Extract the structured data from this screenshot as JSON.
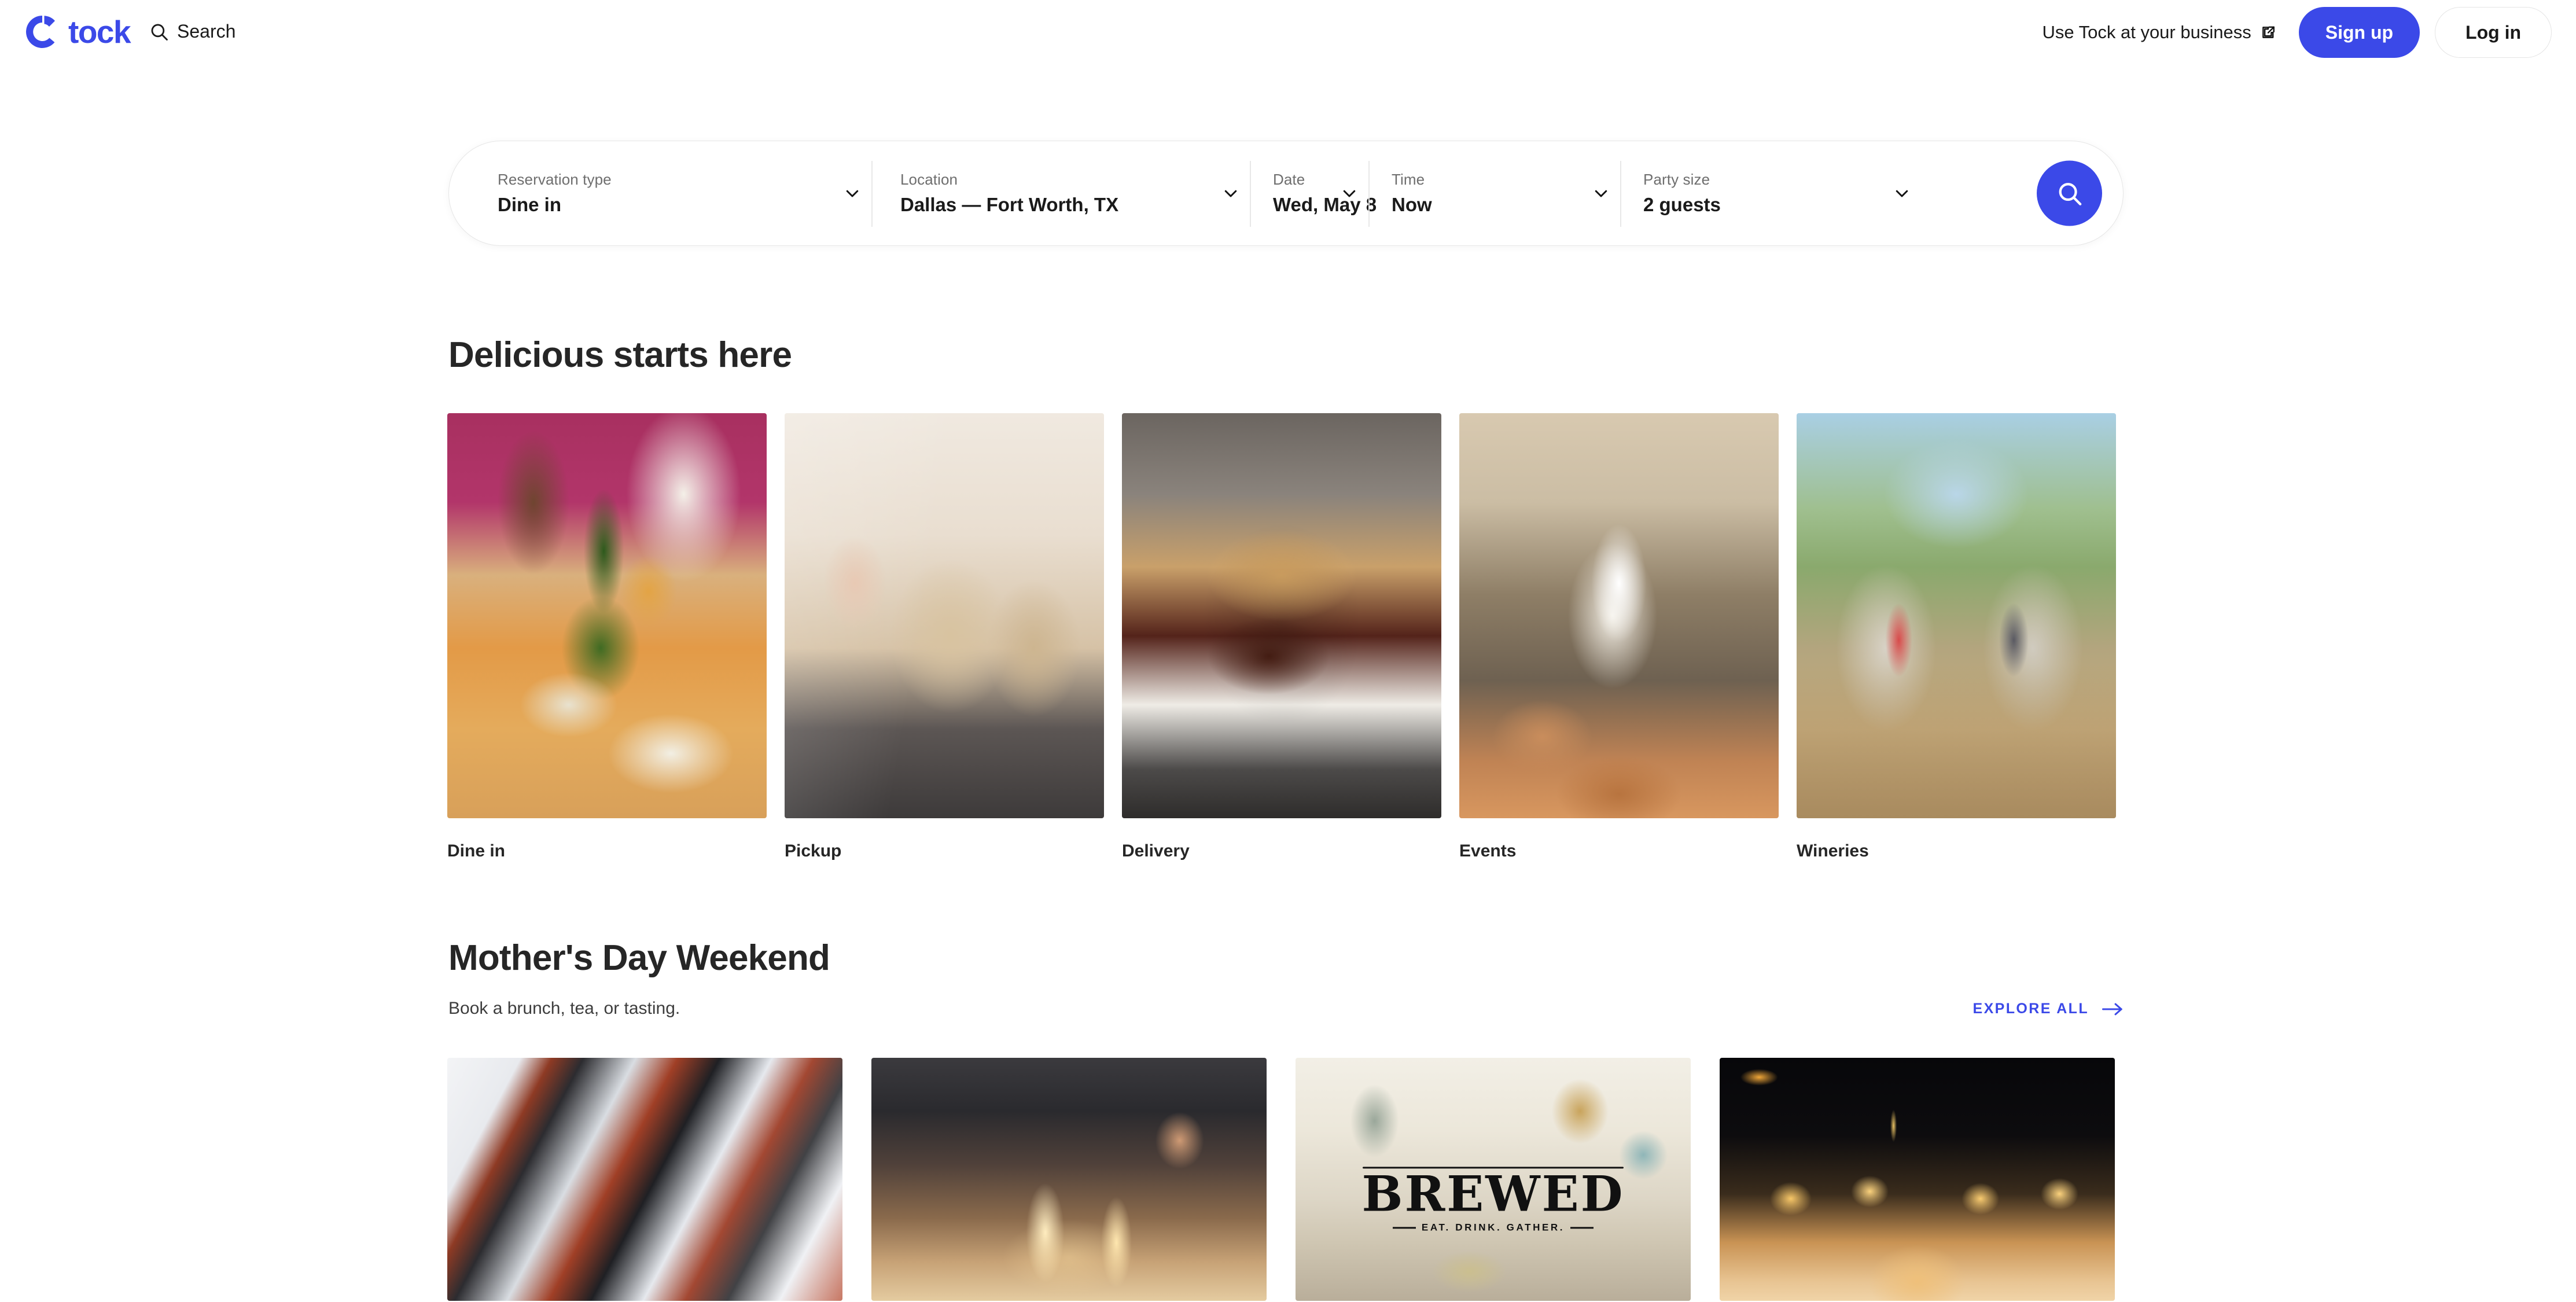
{
  "header": {
    "logo_text": "tock",
    "logo_icon": "tock-ring-logo",
    "search_label": "Search",
    "search_icon": "search-icon",
    "business_link": "Use Tock at your business",
    "external_icon": "external-link-icon",
    "signup_label": "Sign up",
    "login_label": "Log in",
    "accent_color": "#3B49E8"
  },
  "search_bar": {
    "fields": [
      {
        "label": "Reservation type",
        "value": "Dine in",
        "icon": "chevron-down-icon"
      },
      {
        "label": "Location",
        "value": "Dallas — Fort Worth, TX",
        "icon": "chevron-down-icon"
      },
      {
        "label": "Date",
        "value": "Wed, May 8",
        "icon": "chevron-down-icon"
      },
      {
        "label": "Time",
        "value": "Now",
        "icon": "chevron-down-icon"
      },
      {
        "label": "Party size",
        "value": "2 guests",
        "icon": "chevron-down-icon"
      }
    ],
    "submit_icon": "search-icon"
  },
  "sections": {
    "delicious": {
      "title": "Delicious starts here",
      "categories": [
        {
          "label": "Dine in",
          "image": "people-dining-table-with-wine"
        },
        {
          "label": "Pickup",
          "image": "paper-takeout-bags-on-counter"
        },
        {
          "label": "Delivery",
          "image": "bbq-rib-sandwich-in-takeout-box"
        },
        {
          "label": "Events",
          "image": "chef-speaking-at-event"
        },
        {
          "label": "Wineries",
          "image": "women-walking-through-vineyard"
        }
      ]
    },
    "mothers_day": {
      "title": "Mother's Day Weekend",
      "subtitle": "Book a brunch, tea, or tasting.",
      "explore_label": "EXPLORE ALL",
      "explore_icon": "arrow-right-icon",
      "cards": [
        {
          "image": "modern-building-balconies-exterior"
        },
        {
          "image": "people-dining-candlelit-table"
        },
        {
          "image": "brewed-restaurant-interior",
          "overlay_logo": "BREWED",
          "overlay_tagline": "EAT. DRINK. GATHER."
        },
        {
          "image": "honey-drizzle-on-dessert"
        }
      ]
    }
  }
}
